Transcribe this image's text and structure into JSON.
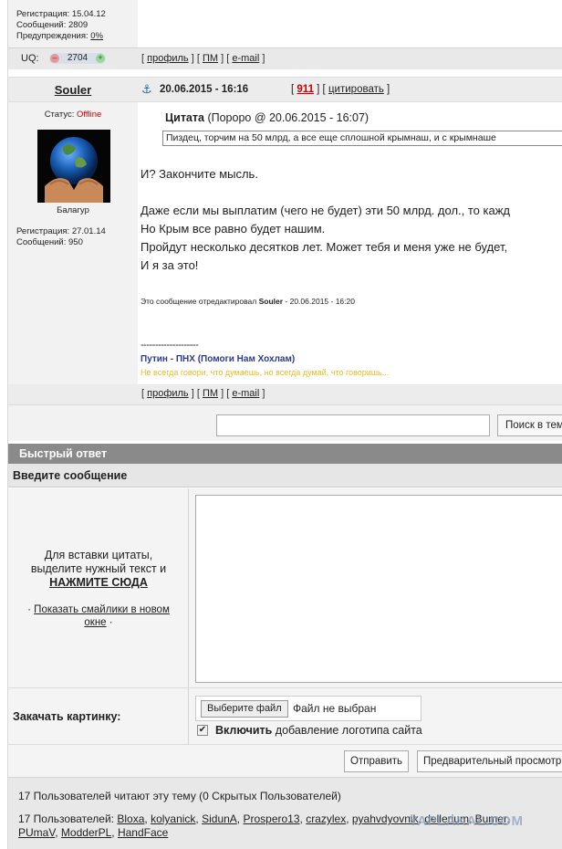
{
  "prev_user": {
    "reg": "Регистрация: 15.04.12",
    "posts": "Сообщений: 2809",
    "warn_label": "Предупреждения: ",
    "warn_value": "0%",
    "uq_label": "UQ:",
    "uq_minus": "–",
    "uq_value": "2704",
    "uq_plus": "+"
  },
  "post_links": {
    "open": "[",
    "profile": "профиль",
    "sep": "] [",
    "pm": "ПМ",
    "email": "e-mail",
    "close": "]"
  },
  "post": {
    "author": "Souler",
    "anchor_icon": "anchor-icon",
    "date": "20.06.2015 - 16:16",
    "rep_open": "[",
    "rep_value": "911",
    "rep_mid": "] [",
    "quote_link": "цитировать",
    "rep_close": "]",
    "status_label": "Статус: ",
    "status_value": "Offline",
    "rank": "Балагур",
    "reg": "Регистрация: 27.01.14",
    "posts": "Сообщений: 950",
    "quote_title": "Цитата",
    "quote_meta": " (Пороро @ 20.06.2015 - 16:07)",
    "quote_text": "Пиздец, торчим на 50 млрд, а все еще сплошной крымнаш, и с крымнаше",
    "lines": [
      "И? Закончите мысль.",
      "Даже если мы выплатим (чего не будет) эти 50 млрд. дол., то кажд",
      "Но Крым все равно будет нашим.",
      "Пройдут несколько десятков лет. Может тебя и меня уже не будет,",
      "И я за это!"
    ],
    "edited_prefix": "Это сообщение отредактировал ",
    "edited_user": "Souler",
    "edited_date": " - 20.06.2015 - 16:20",
    "sig_sep": "--------------------",
    "sig1": "Путин - ПНХ (Помоги Нам Хохлам)",
    "sig2": "Не всегда говори, что думаешь, но всегда думай, что говоришь..."
  },
  "search": {
    "value": "",
    "button": "Поиск в теме"
  },
  "quick_reply": {
    "title": "Быстрый ответ",
    "subtitle": "Введите сообщение",
    "hint_line1": "Для вставки цитаты,",
    "hint_line2": "выделите нужный текст и",
    "hint_click": "НАЖМИТЕ СЮДА",
    "smiles_bullet": "· ",
    "smiles_link": "Показать смайлики в новом окне",
    "smiles_end": " ·",
    "message": "",
    "upload_label": "Закачать картинку:",
    "file_button": "Выберите файл",
    "file_status": "Файл не выбран",
    "logo_bold": "Включить",
    "logo_rest": " добавление логотипа сайта",
    "send": "Отправить",
    "preview": "Предварительный просмотр"
  },
  "readers": {
    "title": "17 Пользователей читают эту тему (0 Скрытых Пользователей)",
    "prefix": "17 Пользователей: ",
    "names": [
      "Bloxa",
      "kolyanick",
      "SidunA",
      "Prospero13",
      "crazylex",
      "pyahvdyovnik",
      "dellerium",
      "Bumer",
      "PUmaV",
      "ModderPL",
      "HandFace"
    ]
  },
  "watermark": "YAPLAKAL.COM",
  "colors": {
    "offline": "#cc0000",
    "rep": "#cc0000",
    "sig1": "#2c3a8c",
    "sig2": "#e6c020",
    "header_gray": "#8a8a8a"
  }
}
